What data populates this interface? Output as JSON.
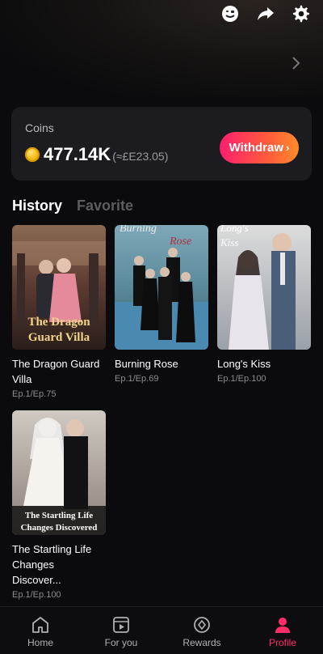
{
  "header": {
    "icons": [
      "emoji-icon",
      "share-icon",
      "settings-icon"
    ]
  },
  "coins": {
    "title": "Coins",
    "amount": "477.14K",
    "approx": "(≈£E23.05)",
    "withdraw_label": "Withdraw",
    "accent_gradient": [
      "#ff1f6e",
      "#ff8b2a"
    ]
  },
  "tabs": [
    {
      "label": "History",
      "active": true
    },
    {
      "label": "Favorite",
      "active": false
    }
  ],
  "history": [
    {
      "title_line1": "The Dragon Guard",
      "title_line2": "Villa",
      "episode": "Ep.1/Ep.75",
      "poster_text_1": "The Dragon",
      "poster_text_2": "Guard Villa"
    },
    {
      "title_line1": "Burning Rose",
      "title_line2": "",
      "episode": "Ep.1/Ep.69",
      "poster_text_1": "Burning",
      "poster_text_2": "Rose"
    },
    {
      "title_line1": "Long's Kiss",
      "title_line2": "",
      "episode": "Ep.1/Ep.100",
      "poster_text_1": "Long's",
      "poster_text_2": "Kiss"
    },
    {
      "title_line1": "The Startling Life",
      "title_line2": "Changes Discover...",
      "episode": "Ep.1/Ep.100",
      "poster_text_1": "The Startling Life",
      "poster_text_2": "Changes Discovered"
    }
  ],
  "nav": [
    {
      "label": "Home",
      "icon": "home-icon",
      "active": false
    },
    {
      "label": "For you",
      "icon": "play-icon",
      "active": false
    },
    {
      "label": "Rewards",
      "icon": "rewards-icon",
      "active": false
    },
    {
      "label": "Profile",
      "icon": "profile-icon",
      "active": true
    }
  ],
  "colors": {
    "background": "#0b0b0d",
    "card": "#1c1c20",
    "active_nav": "#ff2d6a"
  }
}
